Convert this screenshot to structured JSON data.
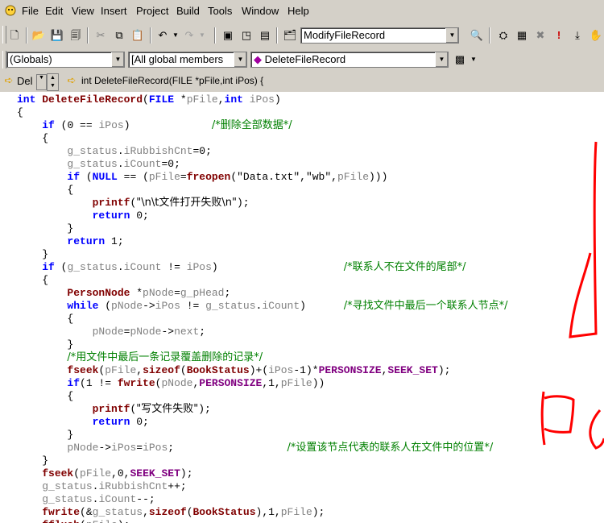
{
  "menu": [
    "File",
    "Edit",
    "View",
    "Insert",
    "Project",
    "Build",
    "Tools",
    "Window",
    "Help"
  ],
  "toolbar": {
    "function_combo": "ModifyFileRecord"
  },
  "wizardbar": {
    "scope": "(Globals)",
    "members": "[All global members",
    "function": "DeleteFileRecord"
  },
  "navbar": {
    "short": "Del",
    "signature": "int DeleteFileRecord(FILE *pFile,int iPos) {"
  },
  "code_lines": [
    [
      [
        "kw",
        "int "
      ],
      [
        "fn",
        "DeleteFileRecord"
      ],
      [
        "pl",
        "("
      ],
      [
        "kw",
        "FILE "
      ],
      [
        "pl",
        "*"
      ],
      [
        "id",
        "pFile"
      ],
      [
        "pl",
        ","
      ],
      [
        "kw",
        "int "
      ],
      [
        "id",
        "iPos"
      ],
      [
        "pl",
        ")"
      ]
    ],
    [
      [
        "pl",
        "{"
      ]
    ],
    [
      [
        "pl",
        "    "
      ],
      [
        "kw",
        "if"
      ],
      [
        "pl",
        " ("
      ],
      [
        "pl",
        "0"
      ],
      [
        "pl",
        " == "
      ],
      [
        "id",
        "iPos"
      ],
      [
        "pl",
        ")             "
      ],
      [
        "cm",
        "/*删除全部数据*/"
      ]
    ],
    [
      [
        "pl",
        "    {"
      ]
    ],
    [
      [
        "pl",
        "        "
      ],
      [
        "id",
        "g_status"
      ],
      [
        "pl",
        "."
      ],
      [
        "id",
        "iRubbishCnt"
      ],
      [
        "pl",
        "=0;"
      ]
    ],
    [
      [
        "pl",
        "        "
      ],
      [
        "id",
        "g_status"
      ],
      [
        "pl",
        "."
      ],
      [
        "id",
        "iCount"
      ],
      [
        "pl",
        "=0;"
      ]
    ],
    [
      [
        "pl",
        "        "
      ],
      [
        "kw",
        "if"
      ],
      [
        "pl",
        " ("
      ],
      [
        "kw",
        "NULL"
      ],
      [
        "pl",
        " == ("
      ],
      [
        "id",
        "pFile"
      ],
      [
        "pl",
        "="
      ],
      [
        "fn",
        "freopen"
      ],
      [
        "pl",
        "("
      ],
      [
        "st",
        "\"Data.txt\""
      ],
      [
        "pl",
        ","
      ],
      [
        "st",
        "\"wb\""
      ],
      [
        "pl",
        ","
      ],
      [
        "id",
        "pFile"
      ],
      [
        "pl",
        ")))"
      ]
    ],
    [
      [
        "pl",
        "        {"
      ]
    ],
    [
      [
        "pl",
        "            "
      ],
      [
        "fn",
        "printf"
      ],
      [
        "pl",
        "("
      ],
      [
        "st",
        "\"\\n\\t文件打开失败\\n\""
      ],
      [
        "pl",
        ");"
      ]
    ],
    [
      [
        "pl",
        "            "
      ],
      [
        "kw",
        "return"
      ],
      [
        "pl",
        " 0;"
      ]
    ],
    [
      [
        "pl",
        "        }"
      ]
    ],
    [
      [
        "pl",
        "        "
      ],
      [
        "kw",
        "return"
      ],
      [
        "pl",
        " 1;"
      ]
    ],
    [
      [
        "pl",
        "    }"
      ]
    ],
    [
      [
        "pl",
        "    "
      ],
      [
        "kw",
        "if"
      ],
      [
        "pl",
        " ("
      ],
      [
        "id",
        "g_status"
      ],
      [
        "pl",
        "."
      ],
      [
        "id",
        "iCount"
      ],
      [
        "pl",
        " != "
      ],
      [
        "id",
        "iPos"
      ],
      [
        "pl",
        ")                    "
      ],
      [
        "cm",
        "/*联系人不在文件的尾部*/"
      ]
    ],
    [
      [
        "pl",
        "    {"
      ]
    ],
    [
      [
        "pl",
        "        "
      ],
      [
        "fn",
        "PersonNode"
      ],
      [
        "pl",
        " *"
      ],
      [
        "id",
        "pNode"
      ],
      [
        "pl",
        "="
      ],
      [
        "id",
        "g_pHead"
      ],
      [
        "pl",
        ";"
      ]
    ],
    [
      [
        "pl",
        "        "
      ],
      [
        "kw",
        "while"
      ],
      [
        "pl",
        " ("
      ],
      [
        "id",
        "pNode"
      ],
      [
        "pl",
        "->"
      ],
      [
        "id",
        "iPos"
      ],
      [
        "pl",
        " != "
      ],
      [
        "id",
        "g_status"
      ],
      [
        "pl",
        "."
      ],
      [
        "id",
        "iCount"
      ],
      [
        "pl",
        ")      "
      ],
      [
        "cm",
        "/*寻找文件中最后一个联系人节点*/"
      ]
    ],
    [
      [
        "pl",
        "        {"
      ]
    ],
    [
      [
        "pl",
        "            "
      ],
      [
        "id",
        "pNode"
      ],
      [
        "pl",
        "="
      ],
      [
        "id",
        "pNode"
      ],
      [
        "pl",
        "->"
      ],
      [
        "id",
        "next"
      ],
      [
        "pl",
        ";"
      ]
    ],
    [
      [
        "pl",
        "        }"
      ]
    ],
    [
      [
        "pl",
        "        "
      ],
      [
        "cm",
        "/*用文件中最后一条记录覆盖删除的记录*/"
      ]
    ],
    [
      [
        "pl",
        "        "
      ],
      [
        "fn",
        "fseek"
      ],
      [
        "pl",
        "("
      ],
      [
        "id",
        "pFile"
      ],
      [
        "pl",
        ","
      ],
      [
        "fn",
        "sizeof"
      ],
      [
        "pl",
        "("
      ],
      [
        "fn",
        "BookStatus"
      ],
      [
        "pl",
        ")+("
      ],
      [
        "id",
        "iPos"
      ],
      [
        "pl",
        "-1)*"
      ],
      [
        "mc",
        "PERSONSIZE"
      ],
      [
        "pl",
        ","
      ],
      [
        "mc",
        "SEEK_SET"
      ],
      [
        "pl",
        ");"
      ]
    ],
    [
      [
        "pl",
        "        "
      ],
      [
        "kw",
        "if"
      ],
      [
        "pl",
        "(1 != "
      ],
      [
        "fn",
        "fwrite"
      ],
      [
        "pl",
        "("
      ],
      [
        "id",
        "pNode"
      ],
      [
        "pl",
        ","
      ],
      [
        "mc",
        "PERSONSIZE"
      ],
      [
        "pl",
        ",1,"
      ],
      [
        "id",
        "pFile"
      ],
      [
        "pl",
        "))"
      ]
    ],
    [
      [
        "pl",
        "        {"
      ]
    ],
    [
      [
        "pl",
        "            "
      ],
      [
        "fn",
        "printf"
      ],
      [
        "pl",
        "("
      ],
      [
        "st",
        "\"写文件失败\""
      ],
      [
        "pl",
        ");"
      ]
    ],
    [
      [
        "pl",
        "            "
      ],
      [
        "kw",
        "return"
      ],
      [
        "pl",
        " 0;"
      ]
    ],
    [
      [
        "pl",
        "        }"
      ]
    ],
    [
      [
        "pl",
        "        "
      ],
      [
        "id",
        "pNode"
      ],
      [
        "pl",
        "->"
      ],
      [
        "id",
        "iPos"
      ],
      [
        "pl",
        "="
      ],
      [
        "id",
        "iPos"
      ],
      [
        "pl",
        ";                  "
      ],
      [
        "cm",
        "/*设置该节点代表的联系人在文件中的位置*/"
      ]
    ],
    [
      [
        "pl",
        "    }"
      ]
    ],
    [
      [
        "pl",
        "    "
      ],
      [
        "fn",
        "fseek"
      ],
      [
        "pl",
        "("
      ],
      [
        "id",
        "pFile"
      ],
      [
        "pl",
        ",0,"
      ],
      [
        "mc",
        "SEEK_SET"
      ],
      [
        "pl",
        ");"
      ]
    ],
    [
      [
        "pl",
        "    "
      ],
      [
        "id",
        "g_status"
      ],
      [
        "pl",
        "."
      ],
      [
        "id",
        "iRubbishCnt"
      ],
      [
        "pl",
        "++;"
      ]
    ],
    [
      [
        "pl",
        "    "
      ],
      [
        "id",
        "g_status"
      ],
      [
        "pl",
        "."
      ],
      [
        "id",
        "iCount"
      ],
      [
        "pl",
        "--;"
      ]
    ],
    [
      [
        "pl",
        "    "
      ],
      [
        "fn",
        "fwrite"
      ],
      [
        "pl",
        "(&"
      ],
      [
        "id",
        "g_status"
      ],
      [
        "pl",
        ","
      ],
      [
        "fn",
        "sizeof"
      ],
      [
        "pl",
        "("
      ],
      [
        "fn",
        "BookStatus"
      ],
      [
        "pl",
        "),1,"
      ],
      [
        "id",
        "pFile"
      ],
      [
        "pl",
        ");"
      ]
    ],
    [
      [
        "pl",
        "    "
      ],
      [
        "fn",
        "fflush"
      ],
      [
        "pl",
        "("
      ],
      [
        "id",
        "pFile"
      ],
      [
        "pl",
        ");"
      ]
    ]
  ],
  "colors": {
    "keyword": "#0000ff",
    "function": "#800000",
    "identifier": "#808080",
    "comment": "#008000",
    "macro": "#800080",
    "annotation": "#ff0000"
  }
}
